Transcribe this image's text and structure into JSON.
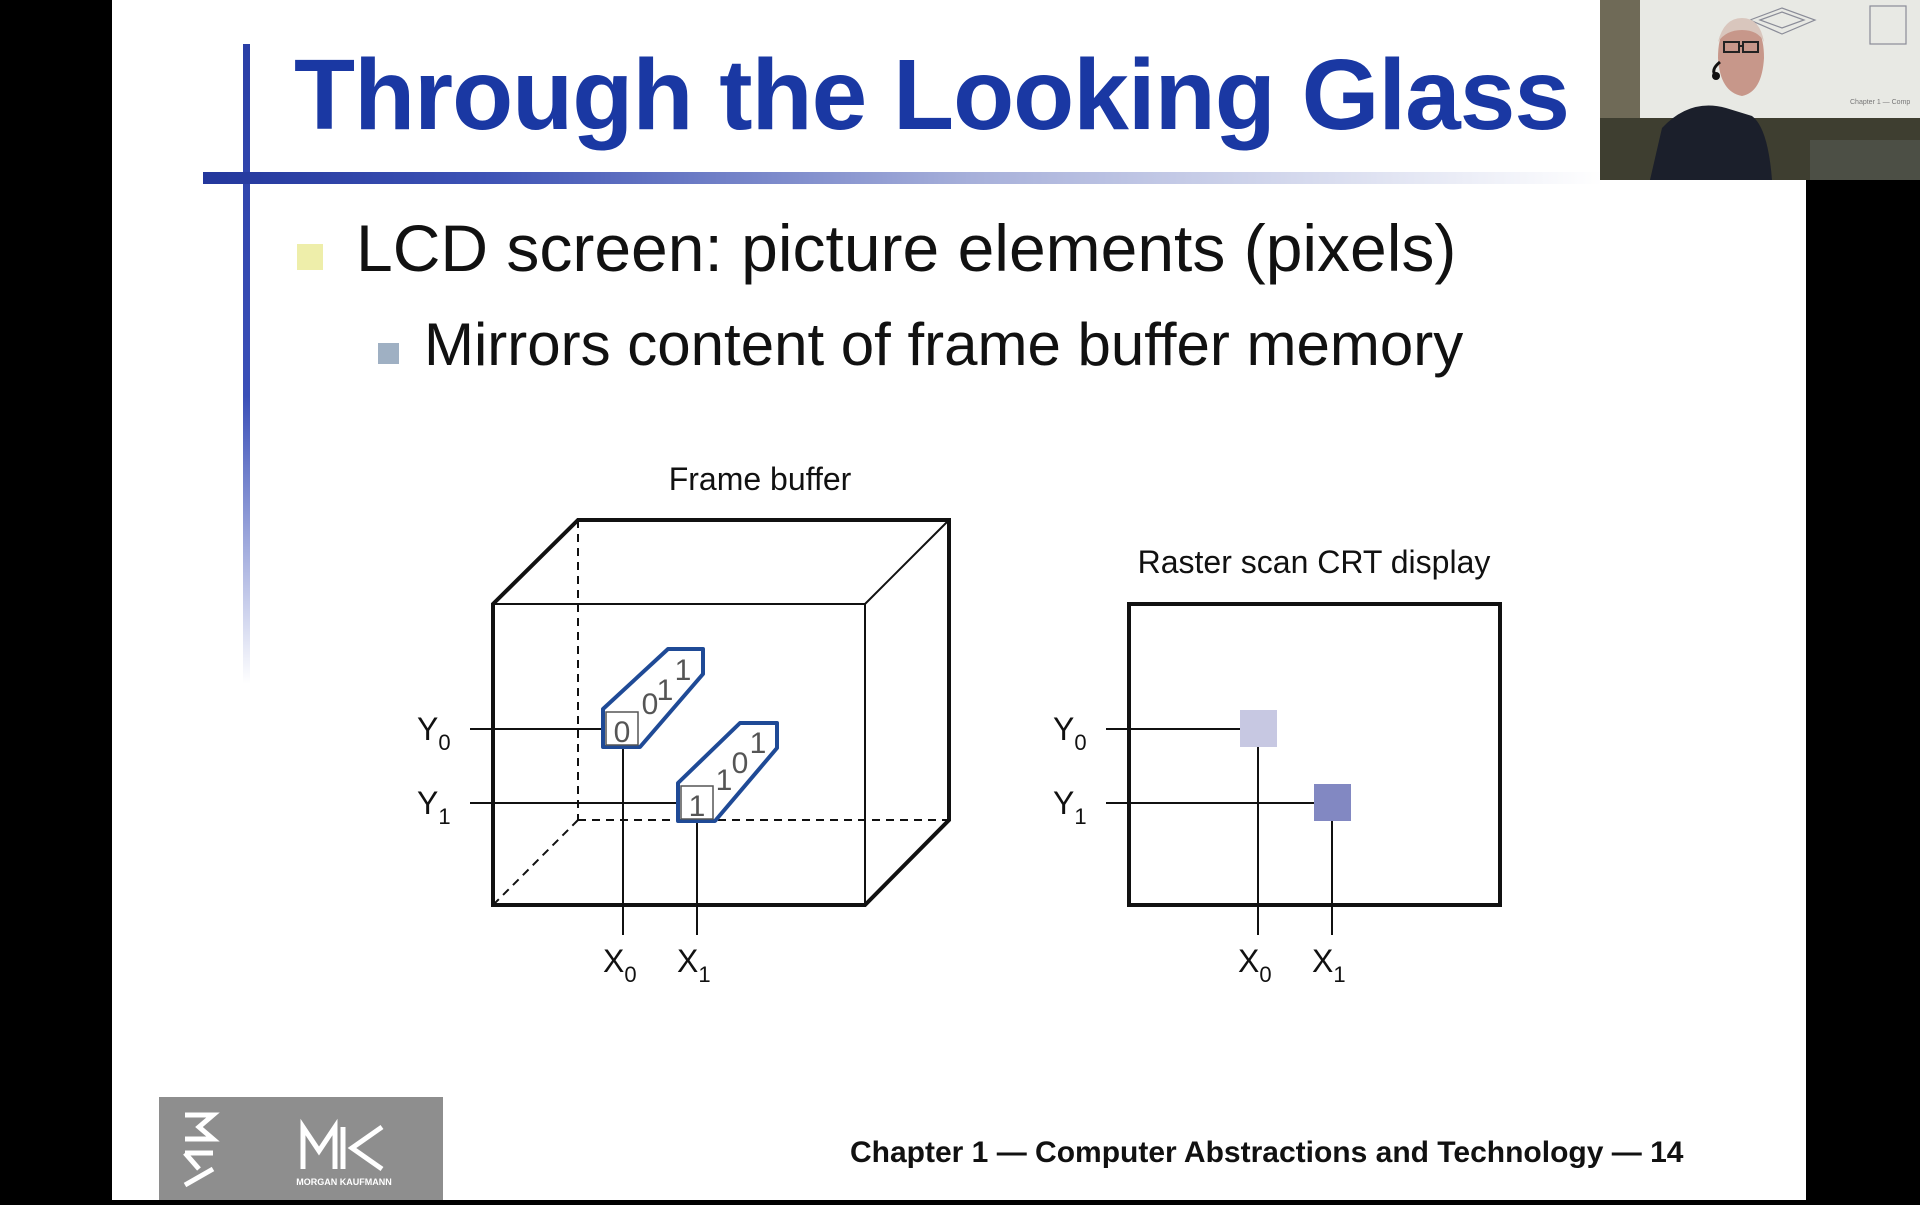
{
  "slide": {
    "title": "Through the Looking Glass",
    "bullets": [
      {
        "text": "LCD screen: picture elements (pixels)"
      },
      {
        "text": "Mirrors content of frame buffer memory"
      }
    ],
    "footer": "Chapter 1 — Computer Abstractions and Technology — 14"
  },
  "diagram": {
    "frame_buffer": {
      "label": "Frame buffer",
      "y_labels": [
        {
          "base": "Y",
          "sub": "0"
        },
        {
          "base": "Y",
          "sub": "1"
        }
      ],
      "x_labels": [
        {
          "base": "X",
          "sub": "0"
        },
        {
          "base": "X",
          "sub": "1"
        }
      ],
      "bit_stacks": [
        {
          "front": "0",
          "back": [
            "0",
            "1",
            "1"
          ]
        },
        {
          "front": "1",
          "back": [
            "1",
            "0",
            "1"
          ]
        }
      ]
    },
    "crt": {
      "label": "Raster scan CRT display",
      "y_labels": [
        {
          "base": "Y",
          "sub": "0"
        },
        {
          "base": "Y",
          "sub": "1"
        }
      ],
      "x_labels": [
        {
          "base": "X",
          "sub": "0"
        },
        {
          "base": "X",
          "sub": "1"
        }
      ]
    }
  },
  "logo": {
    "text": "MK",
    "subtext": "MORGAN KAUFMANN"
  },
  "webcam": {
    "board_caption": "Chapter 1 — Comp"
  },
  "colors": {
    "title": "#1a38a3",
    "accent_bar": "#23379c",
    "bullet_1": "#eeeeaa",
    "bullet_2": "#9fb0c3",
    "highlight_blue": "#1f4a96",
    "pixel_light": "#c7c8e2",
    "pixel_dark": "#8288c2",
    "logo_bg": "#8e8e8e"
  }
}
